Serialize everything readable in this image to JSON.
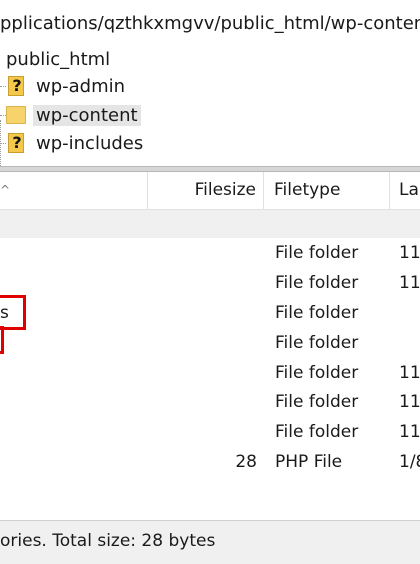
{
  "path_bar": {
    "text": "pplications/qzthkxmgvv/public_html/wp-content"
  },
  "tree": {
    "items": [
      {
        "label": "public_html"
      },
      {
        "label": "wp-admin",
        "icon": "question-folder-icon"
      },
      {
        "label": "wp-content",
        "icon": "folder-icon",
        "selected": true
      },
      {
        "label": "wp-includes",
        "icon": "question-folder-icon"
      }
    ],
    "question_glyph": "?"
  },
  "file_list": {
    "columns": {
      "filesize": "Filesize",
      "filetype": "Filetype",
      "last_modified": "La"
    },
    "sort_indicator": "^",
    "rows": [
      {
        "name": "",
        "size": "",
        "type": "File folder",
        "date": "11,"
      },
      {
        "name": "",
        "size": "",
        "type": "File folder",
        "date": "11,"
      },
      {
        "name": "s",
        "size": "",
        "type": "File folder",
        "date": ""
      },
      {
        "name": "",
        "size": "",
        "type": "File folder",
        "date": ""
      },
      {
        "name": "",
        "size": "",
        "type": "File folder",
        "date": "11,"
      },
      {
        "name": "",
        "size": "",
        "type": "File folder",
        "date": "11,"
      },
      {
        "name": "",
        "size": "",
        "type": "File folder",
        "date": "11,"
      },
      {
        "name": "",
        "size": "28",
        "type": "PHP File",
        "date": "1/8"
      }
    ]
  },
  "status_bar": {
    "text": "ories. Total size: 28 bytes"
  },
  "colors": {
    "highlight_box": "#e10000",
    "selected_row": "#e5e5e5"
  }
}
